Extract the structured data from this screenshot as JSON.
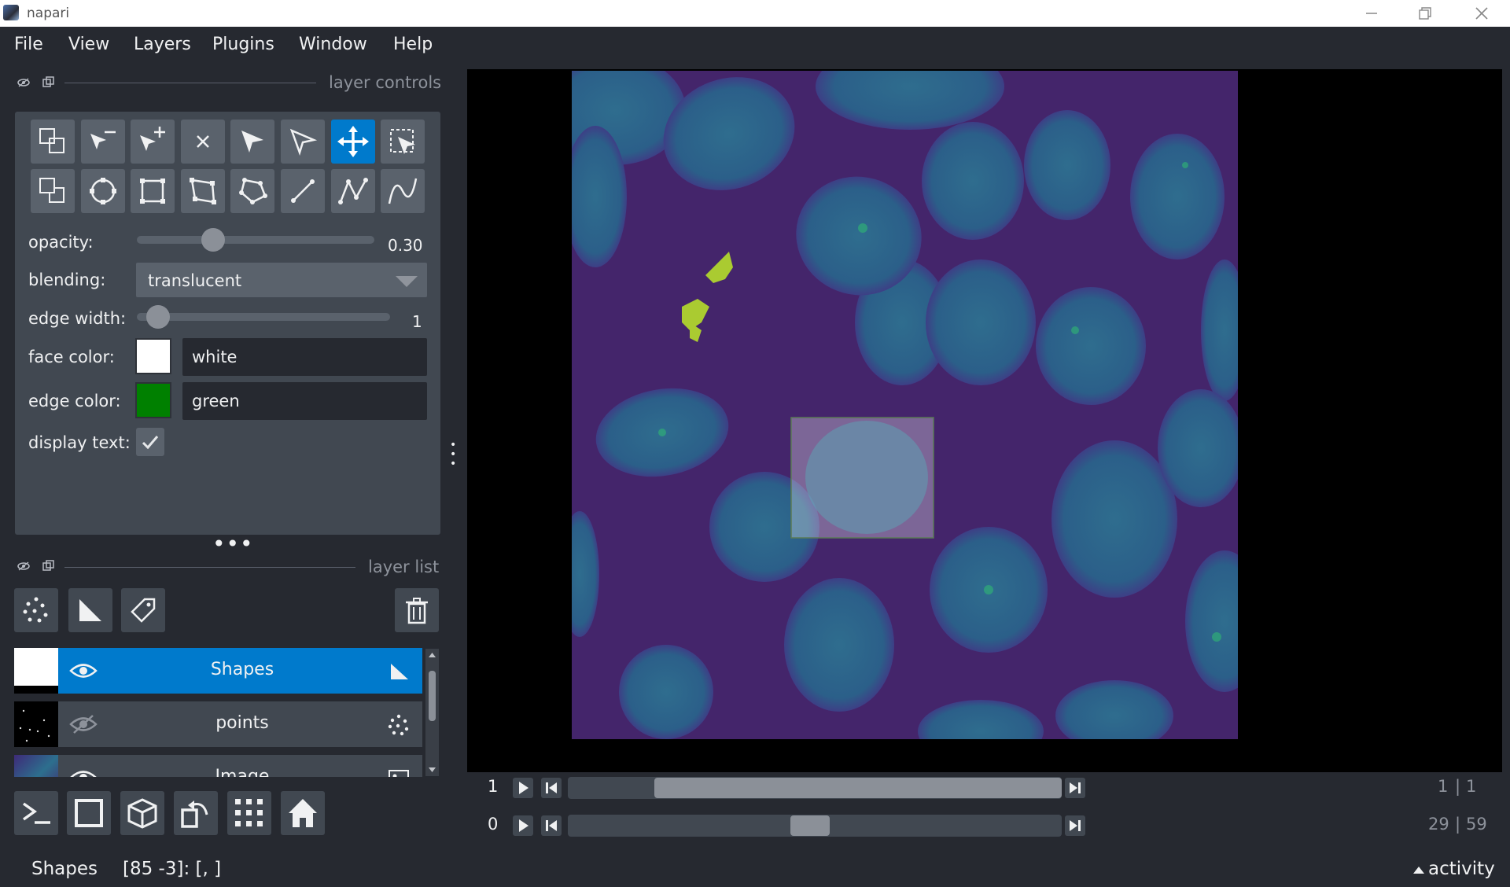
{
  "window": {
    "title": "napari",
    "minimize_icon": "minimize-icon",
    "restore_icon": "restore-icon",
    "close_icon": "close-icon"
  },
  "menu": [
    "File",
    "View",
    "Layers",
    "Plugins",
    "Window",
    "Help"
  ],
  "layer_controls": {
    "header": "layer controls",
    "tools_row1": [
      "shape-move-back-icon",
      "vertex-remove-icon",
      "vertex-insert-icon",
      "delete-shape-icon",
      "select-direct-icon",
      "select-icon",
      "pan-zoom-icon",
      "transform-icon"
    ],
    "tools_row2": [
      "move-front-icon",
      "ellipse-icon",
      "rectangle-icon",
      "rotated-rectangle-icon",
      "polygon-icon",
      "line-icon",
      "path-icon",
      "polyline-curve-icon"
    ],
    "active_tool": "pan-zoom-icon",
    "opacity_label": "opacity:",
    "opacity_value": "0.30",
    "opacity_fraction": 0.3,
    "blending_label": "blending:",
    "blending_value": "translucent",
    "edge_width_label": "edge width:",
    "edge_width_value": "1",
    "edge_width_fraction": 0.04,
    "face_color_label": "face color:",
    "face_color_value": "white",
    "face_color_hex": "#ffffff",
    "edge_color_label": "edge color:",
    "edge_color_value": "green",
    "edge_color_hex": "#008000",
    "display_text_label": "display text:",
    "display_text_checked": true
  },
  "layer_list": {
    "header": "layer list",
    "buttons": [
      "new-points-icon",
      "new-shapes-icon",
      "new-labels-icon",
      "delete-layer-icon"
    ],
    "layers": [
      {
        "name": "Shapes",
        "visible": true,
        "selected": true,
        "type_icon": "shapes-layer-icon"
      },
      {
        "name": "points",
        "visible": false,
        "selected": false,
        "type_icon": "points-layer-icon"
      },
      {
        "name": "Image",
        "visible": true,
        "selected": false,
        "type_icon": "image-layer-icon"
      }
    ]
  },
  "bottom_buttons": [
    "console-icon",
    "ndisplay-2d-icon",
    "ndisplay-3d-icon",
    "roll-icon",
    "grid-icon",
    "home-icon"
  ],
  "dims": [
    {
      "index": "1",
      "position_fraction": 1.0,
      "current": "1",
      "total": "1"
    },
    {
      "index": "0",
      "position_fraction": 0.49,
      "current": "29",
      "total": "59"
    }
  ],
  "status": {
    "layer": "Shapes",
    "coords": "[85 -3]: [, ]",
    "activity": "activity"
  },
  "accent_color": "#007acc",
  "background_color": "#262930"
}
